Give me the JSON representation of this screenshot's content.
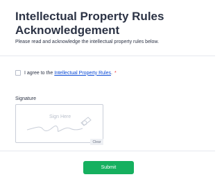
{
  "header": {
    "title": "Intellectual Property Rules Acknowledgement",
    "subtitle": "Please read and acknowledge the intellectual property rules below."
  },
  "consent": {
    "prefix": "I agree to the",
    "link_text": "Intellectual Property Rules",
    "suffix": ".",
    "required_mark": "*"
  },
  "signature": {
    "label": "Signature",
    "placeholder": "Sign Here",
    "clear_label": "Clear"
  },
  "actions": {
    "submit_label": "Submit"
  },
  "colors": {
    "primary_button": "#16b05f",
    "link": "#0a4ad6",
    "required": "#e33333"
  }
}
